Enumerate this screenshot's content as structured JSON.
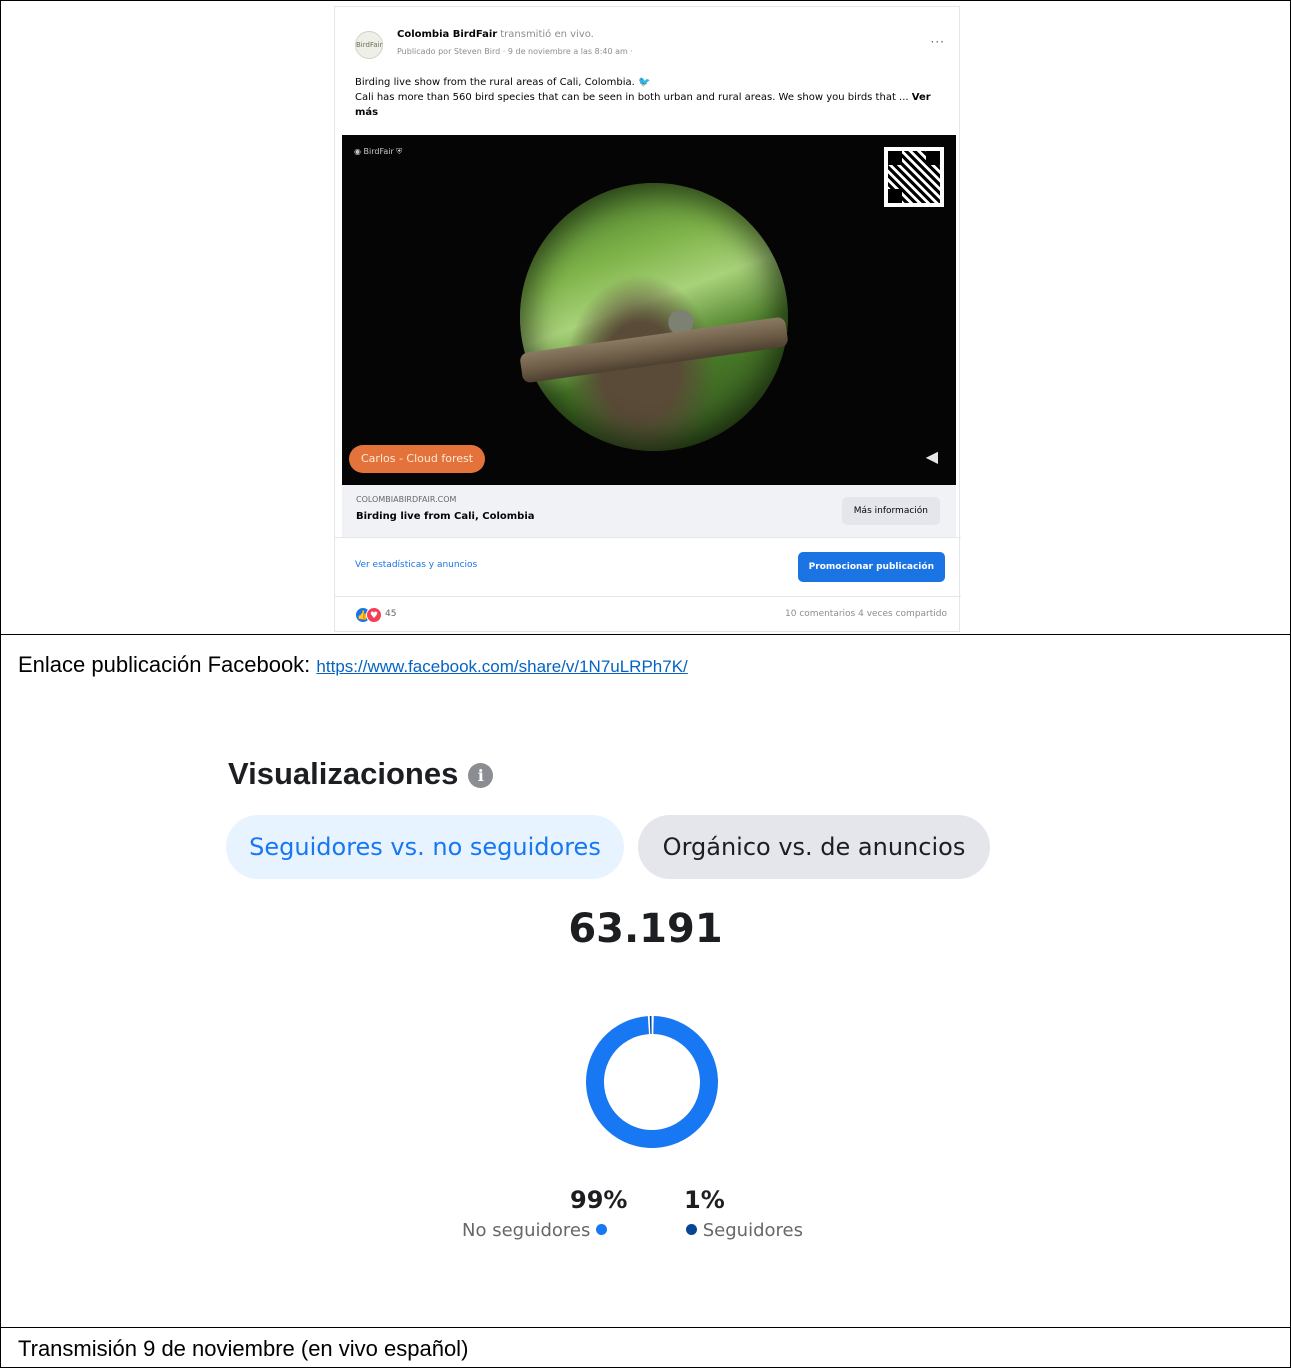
{
  "post": {
    "page_name": "Colombia BirdFair",
    "live_suffix": "transmitió en vivo.",
    "meta": "Publicado por Steven Bird · 9 de noviembre a las 8:40 am ·",
    "avatar_text": "BirdFair",
    "more_icon": "more-dots-icon",
    "text_line1": "Birding live show from the rural areas of Cali, Colombia.",
    "text_line2": "Cali has more than 560 bird species that can be seen in both urban and rural areas. We show you birds that ...",
    "see_more": "Ver más",
    "video_badge": "Carlos - Cloud forest",
    "link_domain": "COLOMBIABIRDFAIR.COM",
    "link_title": "Birding live from Cali, Colombia",
    "more_info_button": "Más información",
    "stats_link": "Ver estadísticas y anuncios",
    "promote_button": "Promocionar publicación",
    "reaction_count": "45",
    "comments_shares": "10 comentarios  4 veces compartido"
  },
  "link_line": {
    "label": "Enlace publicación Facebook: ",
    "url": "https://www.facebook.com/share/v/1N7uLRPh7K/"
  },
  "insights": {
    "title": "Visualizaciones",
    "tab_followers": "Seguidores vs. no seguidores",
    "tab_organic": "Orgánico vs. de anuncios",
    "total": "63.191"
  },
  "chart_data": {
    "type": "pie",
    "title": "",
    "series": [
      {
        "name": "No seguidores",
        "value": 99,
        "label": "99%",
        "color": "#1877f2"
      },
      {
        "name": "Seguidores",
        "value": 1,
        "label": "1%",
        "color": "#0a4595"
      }
    ]
  },
  "caption": "Transmisión 9 de noviembre (en vivo español)",
  "colors": {
    "accent": "#1877f2",
    "followers": "#0a4595",
    "badge": "#e4733b"
  }
}
